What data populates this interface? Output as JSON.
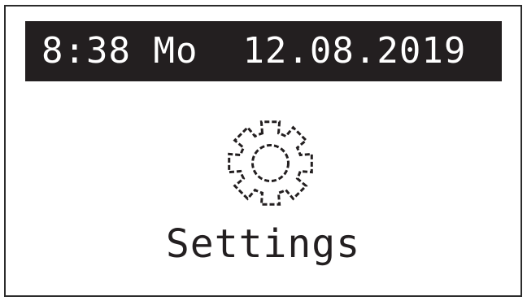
{
  "status_bar": {
    "time": "8:38",
    "weekday": "Mo",
    "date": "12.08.2019"
  },
  "menu": {
    "current_item": {
      "label": "Settings",
      "icon": "gear-icon"
    }
  },
  "colors": {
    "background": "#ffffff",
    "foreground": "#231f20",
    "status_bar_bg": "#231f20",
    "status_bar_fg": "#ffffff"
  }
}
